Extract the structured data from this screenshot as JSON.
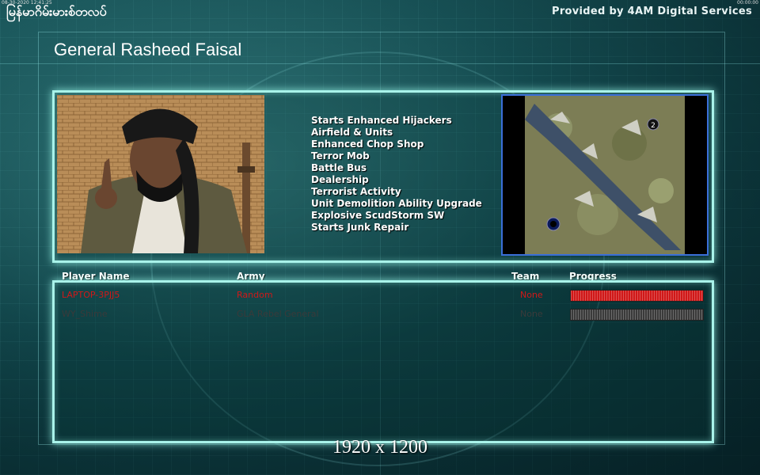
{
  "top": {
    "brand": "မြန်မာဂိမ်းမားစ်တလပ်",
    "timestamp_left": "08-30-2020  12:41:25",
    "timestamp_right": "00:00:00",
    "provided_by": "Provided by 4AM Digital Services"
  },
  "general": {
    "name": "General Rasheed Faisal",
    "features": [
      "Starts Enhanced Hijackers",
      "Airfield & Units",
      "Enhanced Chop Shop",
      "Terror Mob",
      "Battle Bus",
      "Dealership",
      "Terrorist Activity",
      "Unit Demolition Ability Upgrade",
      "Explosive ScudStorm SW",
      "Starts Junk Repair"
    ]
  },
  "minimap": {
    "start_marker": "2"
  },
  "table": {
    "headers": {
      "player": "Player Name",
      "army": "Army",
      "team": "Team",
      "progress": "Progress"
    },
    "rows": [
      {
        "player": "LAPTOP-3PJJ5",
        "army": "Random",
        "team": "None",
        "progress": 1.0,
        "color": "#d01818"
      },
      {
        "player": "WY_Shime",
        "army": "GLA Rebel General",
        "team": "None",
        "progress": 1.0,
        "color": "#3a3a3a"
      }
    ]
  },
  "footer": {
    "resolution": "1920 x 1200"
  },
  "colors": {
    "accent": "#a9f3ea",
    "player1": "#d01818",
    "player2": "#3a3a3a"
  }
}
